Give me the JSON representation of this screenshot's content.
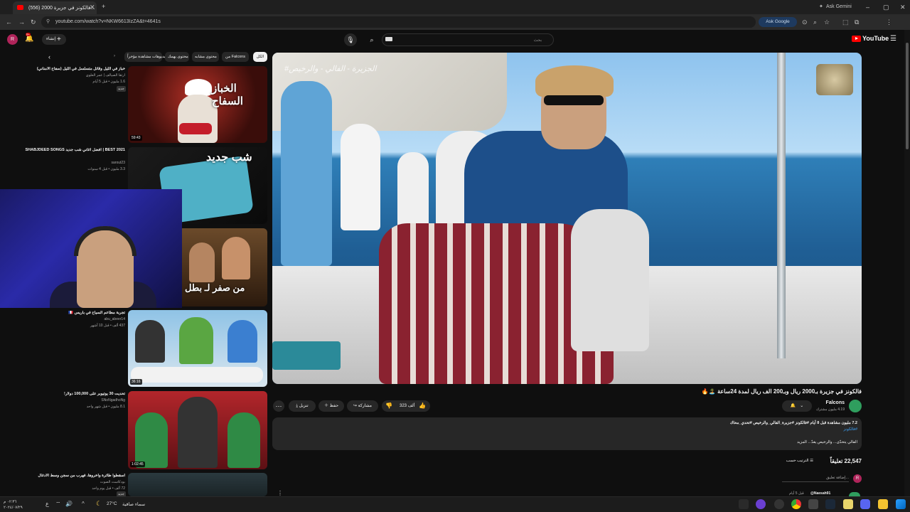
{
  "browser": {
    "tab_title": "(556) فالكونز في جزيرة 2000...",
    "tab_count_badge": "",
    "url": "youtube.com/watch?v=NKW6613IzZA&t=4641s",
    "ask_google": "Ask Google",
    "ask_gemini": "Ask Gemini",
    "profile_initial": "R"
  },
  "youtube": {
    "logo": "YouTube",
    "search_placeholder": "بحث",
    "create_label": "إنشاء",
    "notification_count": "9+",
    "avatar_initial": "R"
  },
  "chips": [
    "الكل",
    "من Falcons",
    "محتوى مشابه",
    "محتوى يهمك",
    "فيديوهات مشاهدة مؤخراً"
  ],
  "video": {
    "watermark": "#الجزيرة - الفالي - والرخيص",
    "title": "فالكونز في جزيرة بـ2000 ريال وبـ200 الف ريال لمدة 24ساعة 🏝️🔥",
    "channel": "Falcons",
    "subscribers": "4.19 مليون مشترك",
    "likes": "323 ألف",
    "share": "مشاركة",
    "save": "حفظ",
    "download": "تنزيل",
    "more": "⋯",
    "description": {
      "stats": "7.2 مليون مشاهدة قبل 8 أيام #فالكونز #جزيرة_الفالي_والرخيص #تحدي_محاك",
      "tags": "#فالكونز",
      "line": "الفالي يتحدّى... والرخيص يقدّ... المزيد"
    },
    "comments_count": "22,547 تعليقاً",
    "sort_label": "الترتيب حسب",
    "add_comment": "إضافة تعليق...",
    "first_comment_user": "@Naesah91",
    "first_comment_time": "قبل 5 أيام"
  },
  "sidebar": [
    {
      "thumb_text": "الخباز السفاح",
      "duration": "59:43",
      "title": "خباز في الليل وقاتل متسلسل في الليل (سفاح الأمناني)",
      "channel": "ارتقا الصيالف | عمر العلوي",
      "meta": "1.6 مليون • قبل 5 أيام",
      "badge": "جديد"
    },
    {
      "thumb_text": "شب جديد",
      "duration": "",
      "title": "BEST 2021 | أفضل أغاني شب جديد SHABJDEED SONGS",
      "channel": "sarout23",
      "meta": "3.3 مليون • قبل 4 سنوات"
    },
    {
      "thumb_text": "من صفر لـ بطل",
      "duration": "",
      "title": "",
      "channel": "",
      "meta": ""
    },
    {
      "thumb_text": "",
      "duration": "36:16",
      "title": "تجربة مطاعم السياح في باريس 🇫🇷",
      "channel": "abu_abeer14",
      "meta": "437 ألف • قبل 10 أشهر"
    },
    {
      "thumb_text": "",
      "duration": "1:02:45",
      "title": "تحديت 30 يوتيوبر على 100,000 دولار!",
      "channel": "SNoNgadhoNg",
      "meta": "8.1 مليون • قبل شهر واحد"
    },
    {
      "thumb_text": "",
      "duration": "",
      "title": "أسقطوا طائرة وأخروها، فهرب من سجن وسط الأدغال",
      "channel": "بودكاست الصوت",
      "meta": "72 ألف • قبل يوم واحد",
      "badge": "جديد"
    }
  ],
  "taskbar": {
    "weather_temp": "27°C",
    "weather_label": "سماء صافية",
    "time": "٠٢:٣٦ م",
    "date": "٢٠٢٤/٠٧/٢٩"
  }
}
